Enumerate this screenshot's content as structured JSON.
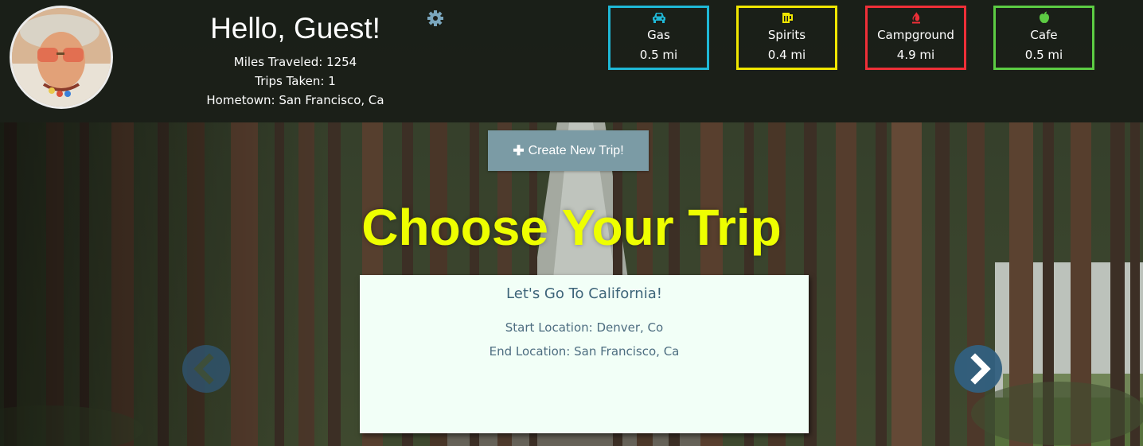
{
  "user": {
    "greeting": "Hello, Guest!",
    "miles_traveled": "Miles Traveled: 1254",
    "trips_taken": "Trips Taken: 1",
    "hometown": "Hometown: San Francisco, Ca"
  },
  "settings_icon": "gear-icon",
  "places": [
    {
      "name": "Gas",
      "distance": "0.5 mi",
      "icon": "car-icon",
      "color": "#1fb8d6"
    },
    {
      "name": "Spirits",
      "distance": "0.4 mi",
      "icon": "beer-mug-icon",
      "color": "#f0e600"
    },
    {
      "name": "Campground",
      "distance": "4.9 mi",
      "icon": "fire-icon",
      "color": "#ef2f38"
    },
    {
      "name": "Cafe",
      "distance": "0.5 mi",
      "icon": "apple-icon",
      "color": "#5ccc43"
    }
  ],
  "create_button": {
    "label": "Create New Trip!",
    "icon": "plus-icon"
  },
  "page_title": "Choose Your Trip",
  "trip": {
    "title": "Let's Go To California!",
    "start": "Start Location: Denver, Co",
    "end": "End Location: San Francisco, Ca"
  },
  "carousel": {
    "prev_icon": "chevron-left-icon",
    "next_icon": "chevron-right-icon"
  },
  "colors": {
    "title_yellow": "#eeff00",
    "button_bg": "#7b9ba5",
    "card_bg": "#f2fff7",
    "card_text": "#3d6479",
    "arrow_bg": "#325f80"
  }
}
